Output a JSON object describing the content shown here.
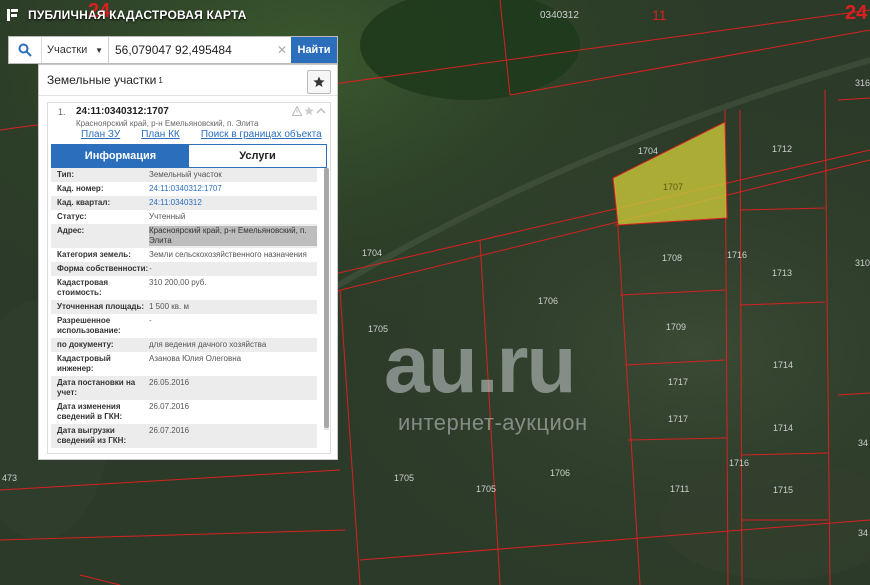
{
  "header": {
    "title": "ПУБЛИЧНАЯ КАДАСТРОВАЯ КАРТА"
  },
  "search": {
    "type_value": "Участки",
    "query_value": "56,079047 92,495484",
    "find_label": "Найти"
  },
  "panel": {
    "title": "Земельные участки",
    "count_sup": "1",
    "item": {
      "number": "1.",
      "cadastral_number": "24:11:0340312:1707",
      "address": "Красноярский край, р-н Емельяновский, п. Элита",
      "links": [
        "План ЗУ →",
        "План КК →",
        "Поиск в границах объекта →"
      ]
    },
    "tabs": [
      "Информация",
      "Услуги"
    ],
    "rows": [
      {
        "label": "Тип:",
        "value": "Земельный участок"
      },
      {
        "label": "Кад. номер:",
        "value": "24:11:0340312:1707"
      },
      {
        "label": "Кад. квартал:",
        "value": "24:11:0340312"
      },
      {
        "label": "Статус:",
        "value": "Учтенный"
      },
      {
        "label": "Адрес:",
        "value": "Красноярский край, р-н Емельяновский, п. Элита"
      },
      {
        "label": "Категория земель:",
        "value": "Земли сельскохозяйственного назначения"
      },
      {
        "label": "Форма собственности:",
        "value": "-"
      },
      {
        "label": "Кадастровая стоимость:",
        "value": "310 200,00 руб."
      },
      {
        "label": "Уточненная площадь:",
        "value": "1 500 кв. м"
      },
      {
        "label": "Разрешенное использование:",
        "value": "-"
      },
      {
        "label": "по документу:",
        "value": "для ведения дачного хозяйства"
      },
      {
        "label": "Кадастровый инженер:",
        "value": "Азанова Юлия Олеговна"
      },
      {
        "label": "Дата постановки на учет:",
        "value": "26.05.2016"
      },
      {
        "label": "Дата изменения сведений в ГКН:",
        "value": "26.07.2016"
      },
      {
        "label": "Дата выгрузки сведений из ГКН:",
        "value": "26.07.2016"
      }
    ]
  },
  "map": {
    "quarter_labels": [
      "24",
      "0340312",
      "11",
      "24"
    ],
    "parcel_labels": [
      "1704",
      "1707",
      "1712",
      "1704",
      "1706",
      "1705",
      "1708",
      "1716",
      "1713",
      "1709",
      "1717",
      "1717",
      "1714",
      "1714",
      "1716",
      "1706",
      "1705",
      "1705",
      "1711",
      "1715",
      "316",
      "310",
      "473",
      "34",
      "34"
    ]
  },
  "watermark": {
    "main": "au.ru",
    "sub": "интернет-аукцион"
  },
  "colors": {
    "accent": "#2b6fbc",
    "boundary": "#d92020",
    "selected_parcel": "#c9c83a"
  }
}
